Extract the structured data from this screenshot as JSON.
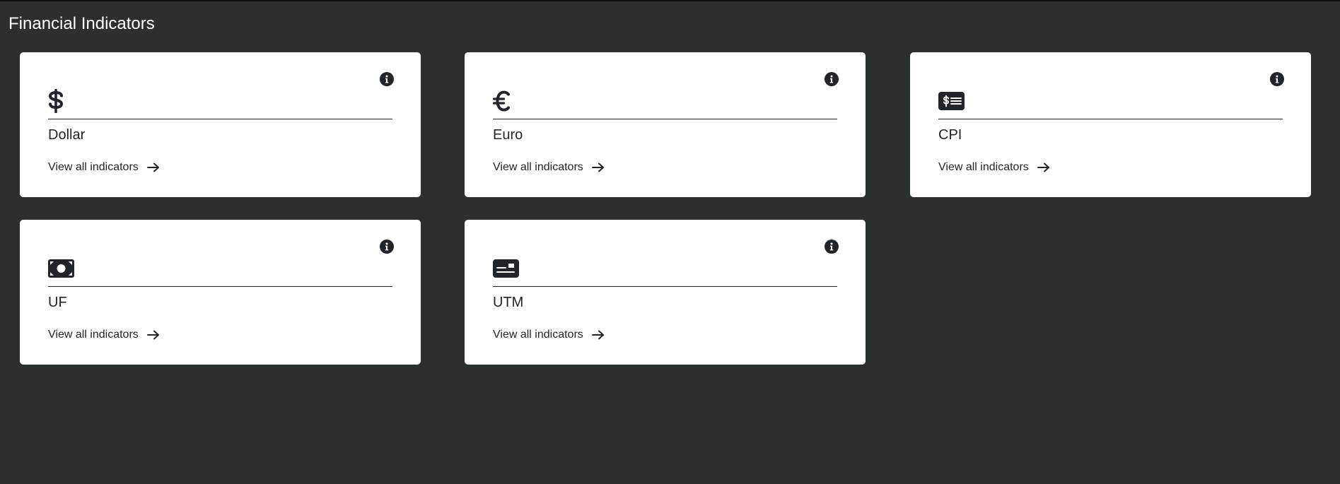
{
  "page": {
    "title": "Financial Indicators"
  },
  "colors": {
    "background": "#2b302d",
    "card": "#ffffff",
    "text": "#212529"
  },
  "cards": [
    {
      "title": "Dollar",
      "icon": "dollar-icon",
      "link_label": "View all indicators"
    },
    {
      "title": "Euro",
      "icon": "euro-icon",
      "link_label": "View all indicators"
    },
    {
      "title": "CPI",
      "icon": "money-check-dollar-icon",
      "link_label": "View all indicators"
    },
    {
      "title": "UF",
      "icon": "money-bill-icon",
      "link_label": "View all indicators"
    },
    {
      "title": "UTM",
      "icon": "money-check-icon",
      "link_label": "View all indicators"
    }
  ]
}
